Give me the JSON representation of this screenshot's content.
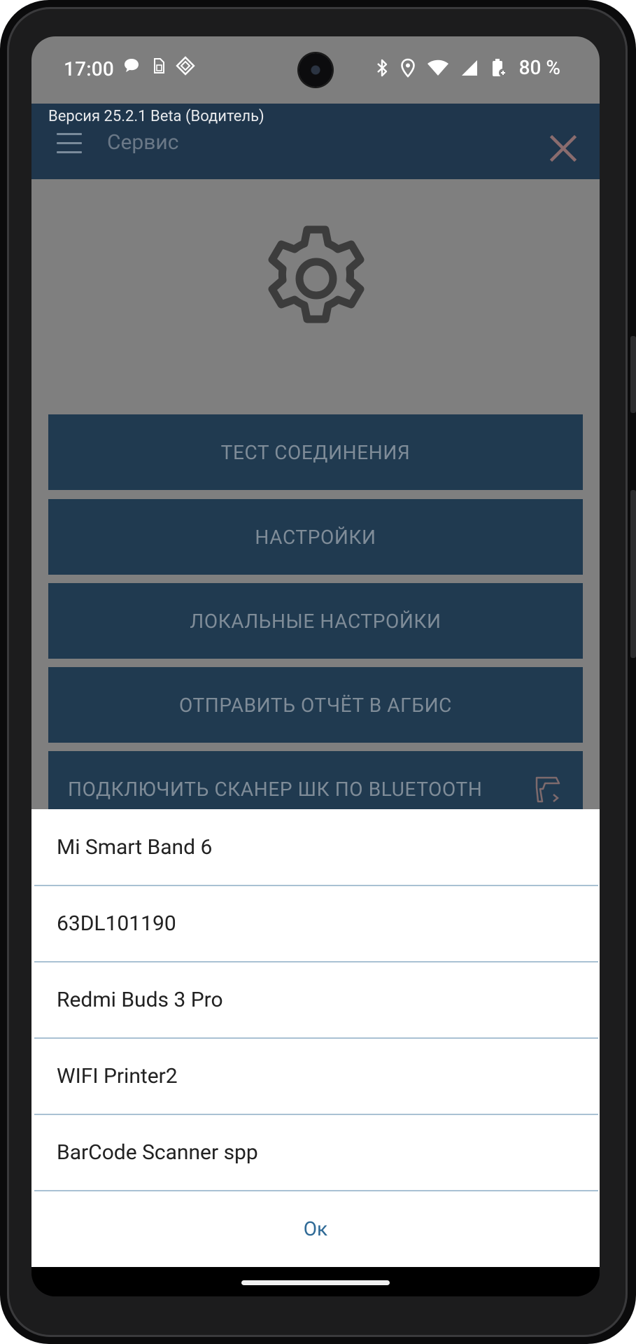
{
  "status_bar": {
    "time": "17:00",
    "battery": "80 %",
    "left_icons": [
      "chat-bubble-icon",
      "sim-icon",
      "location-diamond-icon"
    ],
    "right_icons": [
      "bluetooth-icon",
      "location-pin-icon",
      "wifi-icon",
      "cell-signal-icon",
      "battery-saver-icon"
    ]
  },
  "app_bar": {
    "version": "Версия 25.2.1 Beta (Водитель)",
    "title": "Сервис"
  },
  "menu": {
    "buttons": [
      {
        "label": "ТЕСТ СОЕДИНЕНИЯ"
      },
      {
        "label": "НАСТРОЙКИ"
      },
      {
        "label": "ЛОКАЛЬНЫЕ НАСТРОЙКИ"
      },
      {
        "label": "ОТПРАВИТЬ ОТЧЁТ В АГБИС"
      },
      {
        "label": "ПОДКЛЮЧИТЬ СКАНЕР ШК ПО BLUETOOTH"
      }
    ]
  },
  "device_sheet": {
    "devices": [
      {
        "name": "Mi Smart Band 6"
      },
      {
        "name": "63DL101190"
      },
      {
        "name": "Redmi Buds 3 Pro"
      },
      {
        "name": "WIFI Printer2"
      },
      {
        "name": "BarCode Scanner spp"
      }
    ],
    "ok_label": "Ок"
  },
  "colors": {
    "app_bar": "#1f364c",
    "button_bg": "#203a50",
    "overlay_gray": "#7f7f7f",
    "divider": "#a9c1d3",
    "ok_text": "#2f6a96"
  }
}
